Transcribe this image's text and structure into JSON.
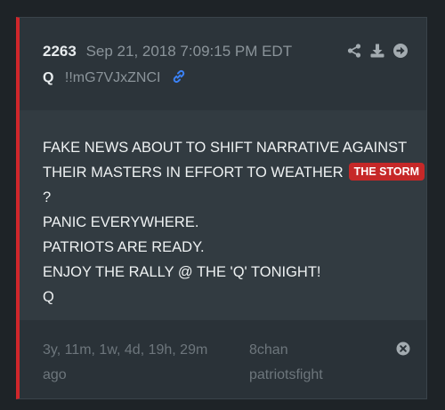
{
  "post": {
    "number": "2263",
    "timestamp": "Sep 21, 2018 7:09:15 PM EDT",
    "author": "Q",
    "tripcode": "!!mG7VJxZNCI"
  },
  "message": {
    "line1": "FAKE NEWS ABOUT TO SHIFT NARRATIVE AGAINST",
    "line2": "THEIR MASTERS IN EFFORT TO WEATHER",
    "tag": "THE STORM",
    "line3": "?",
    "line4": "PANIC EVERYWHERE.",
    "line5": "PATRIOTS ARE READY.",
    "line6": "ENJOY THE RALLY @ THE 'Q' TONIGHT!",
    "line7": "Q"
  },
  "footer": {
    "ago": "3y, 11m, 1w, 4d, 19h, 29m ago",
    "source": "8chan",
    "board": "patriotsfight"
  },
  "colors": {
    "accent_border": "#d0262b",
    "tag_bg": "#c62828",
    "link_icon": "#3b82f6"
  },
  "icons": {
    "actions": [
      "share-icon",
      "download-icon",
      "arrow-right-circle-icon"
    ],
    "author_link": "link-icon",
    "footer": "close-circle-icon"
  }
}
